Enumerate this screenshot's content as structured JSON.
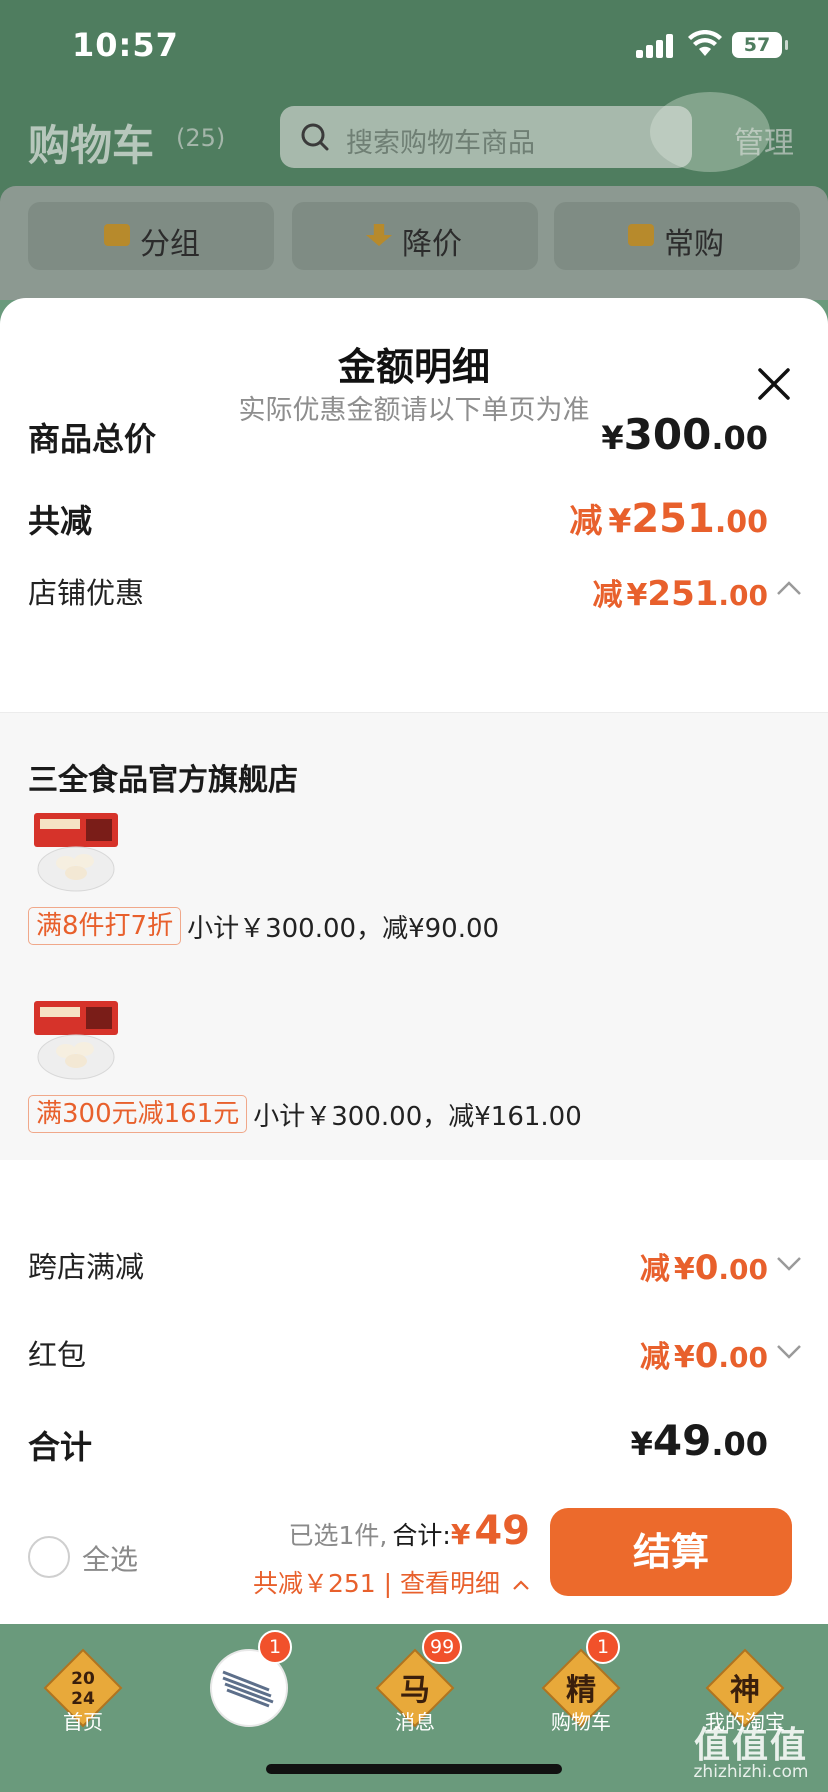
{
  "status_bar": {
    "time": "10:57",
    "battery": "57"
  },
  "background": {
    "title": "购物车",
    "count": "(25)",
    "search_placeholder": "搜索购物车商品",
    "manage": "管理",
    "tabs": [
      "分组",
      "降价",
      "常购"
    ]
  },
  "sheet": {
    "title": "金额明细",
    "subtitle": "实际优惠金额请以下单页为准",
    "total_price": {
      "label": "商品总价",
      "symbol": "¥",
      "int": "300",
      "dec": ".00"
    },
    "total_reduce": {
      "label": "共减",
      "prefix": "减",
      "symbol": "¥",
      "int": "251",
      "dec": ".00"
    },
    "store_discount": {
      "label": "店铺优惠",
      "prefix": "减",
      "symbol": "¥",
      "int": "251",
      "dec": ".00"
    },
    "store": {
      "name": "三全食品官方旗舰店",
      "items": [
        {
          "tag": "满8件打7折",
          "text": "小计￥300.00，减¥90.00"
        },
        {
          "tag": "满300元减161元",
          "text": "小计￥300.00，减¥161.00"
        }
      ]
    },
    "cross_store": {
      "label": "跨店满减",
      "prefix": "减",
      "symbol": "¥",
      "int": "0",
      "dec": ".00"
    },
    "red_packet": {
      "label": "红包",
      "prefix": "减",
      "symbol": "¥",
      "int": "0",
      "dec": ".00"
    },
    "sum": {
      "label": "合计",
      "symbol": "¥",
      "int": "49",
      "dec": ".00"
    }
  },
  "checkout": {
    "select_all": "全选",
    "selected_count": "已选1件,",
    "total_label": "合计:",
    "total_symbol": "¥",
    "total_value": "49",
    "detail": "共减￥251 | 查看明细",
    "button": "结算"
  },
  "tabbar": {
    "items": [
      {
        "label": "首页",
        "badge": ""
      },
      {
        "label": "",
        "badge": "1"
      },
      {
        "label": "消息",
        "badge": "99"
      },
      {
        "label": "购物车",
        "badge": "1"
      },
      {
        "label": "我的淘宝",
        "badge": ""
      }
    ]
  },
  "watermark": {
    "big": "值值值",
    "small": "zhizhizhi.com"
  },
  "colors": {
    "accent": "#e8602c",
    "button": "#ec6a2c",
    "tabbar": "#6a9a7c"
  }
}
